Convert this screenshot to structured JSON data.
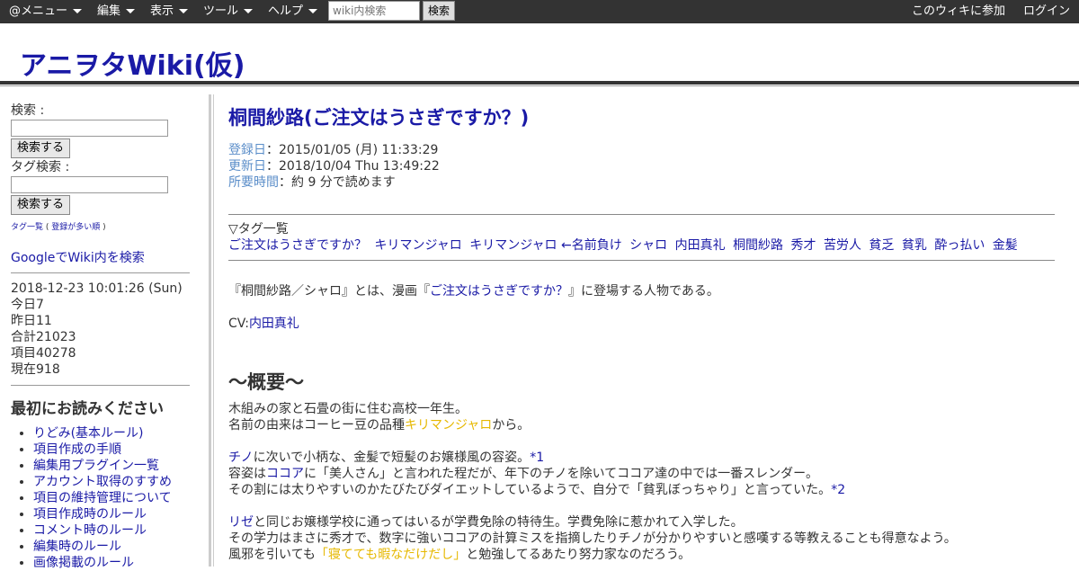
{
  "topbar": {
    "menus": [
      {
        "label": "@メニュー"
      },
      {
        "label": "編集"
      },
      {
        "label": "表示"
      },
      {
        "label": "ツール"
      },
      {
        "label": "ヘルプ"
      }
    ],
    "search_placeholder": "wiki内検索",
    "search_button": "検索",
    "join_label": "このウィキに参加",
    "login_label": "ログイン"
  },
  "site": {
    "title": "アニヲタWiki(仮)"
  },
  "sidebar": {
    "search_label": "検索 :",
    "search_button": "検索する",
    "tag_search_label": "タグ検索 :",
    "tag_search_button": "検索する",
    "tag_list": "タグ一覧",
    "tag_list_sep": " ( ",
    "tag_popular": "登録が多い順",
    "tag_list_end": " )",
    "google_search": "GoogleでWiki内を検索",
    "stats": {
      "datetime": "2018-12-23 10:01:26 (Sun)",
      "today": "今日7",
      "yesterday": "昨日11",
      "total": "合計21023",
      "items": "項目40278",
      "current": "現在918"
    },
    "read_first_title": "最初にお読みください",
    "read_first_items": [
      "りどみ(基本ルール)",
      "項目作成の手順",
      "編集用プラグイン一覧",
      "アカウント取得のすすめ",
      "項目の維持管理について",
      "項目作成時のルール",
      "コメント時のルール",
      "編集時のルール",
      "画像掲載のルール"
    ]
  },
  "article": {
    "title": "桐間紗路(ご注文はうさぎですか？)",
    "registered_label": "登録日",
    "registered_value": "：2015/01/05 (月) 11:33:29",
    "updated_label": "更新日",
    "updated_value": "：2018/10/04 Thu 13:49:22",
    "time_label": "所要時間",
    "time_value": "：約 9 分で読めます",
    "tag_header": "▽タグ一覧",
    "tags": [
      "ご注文はうさぎですか？",
      "キリマンジャロ",
      "キリマンジャロ ←名前負け",
      "シャロ",
      "内田真礼",
      "桐間紗路",
      "秀才",
      "苦労人",
      "貧乏",
      "貧乳",
      "酔っ払い",
      "金髪"
    ],
    "intro_pre": "『桐間紗路／シャロ』とは、漫画『",
    "intro_link": "ご注文はうさぎですか？",
    "intro_post": "』に登場する人物である。",
    "cv_label": "CV:",
    "cv_link": "内田真礼",
    "section_title": "～概要～",
    "p1_line1": "木組みの家と石畳の街に住む高校一年生。",
    "p1_line2_pre": "名前の由来はコーヒー豆の品種",
    "p1_line2_link": "キリマンジャロ",
    "p1_line2_post": "から。",
    "p2_line1_link": "チノ",
    "p2_line1_text": "に次いで小柄な、金髪で短髪のお嬢様風の容姿。",
    "p2_line1_note": "*1",
    "p2_line2_pre": "容姿は",
    "p2_line2_link": "ココア",
    "p2_line2_post": "に「美人さん」と言われた程だが、年下のチノを除いてココア達の中では一番スレンダー。",
    "p2_line3_text": "その割には太りやすいのかたびたびダイエットしているようで、自分で「貧乳ぼっちゃり」と言っていた。",
    "p2_line3_note": "*2",
    "p3_line1_link": "リゼ",
    "p3_line1_text": "と同じお嬢様学校に通ってはいるが学費免除の特待生。学費免除に惹かれて入学した。",
    "p3_line2": "その学力はまさに秀才で、数字に強いココアの計算ミスを指摘したりチノが分かりやすいと感嘆する等教えることも得意なよう。",
    "p3_line3_pre": "風邪を引いても",
    "p3_line3_link": "「寝てても暇なだけだし」",
    "p3_line3_post": "と勉強してるあたり努力家なのだろう。"
  }
}
